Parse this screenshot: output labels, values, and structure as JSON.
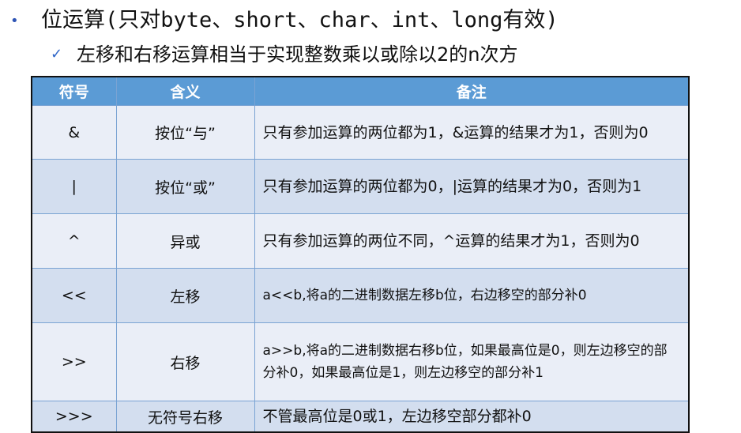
{
  "title": {
    "bullet": "•",
    "text": "位运算(只对byte、short、char、int、long有效)"
  },
  "subtitle": {
    "check": "✓",
    "text": "左移和右移运算相当于实现整数乘以或除以2的n次方"
  },
  "table": {
    "headers": [
      "符号",
      "含义",
      "备注"
    ],
    "rows": [
      {
        "symbol": "&",
        "meaning": "按位“与”",
        "note": "只有参加运算的两位都为1，&运算的结果才为1，否则为0"
      },
      {
        "symbol": "|",
        "meaning": "按位“或”",
        "note": "只有参加运算的两位都为0，|运算的结果才为0，否则为1"
      },
      {
        "symbol": "^",
        "meaning": "异或",
        "note": "只有参加运算的两位不同，^运算的结果才为1，否则为0"
      },
      {
        "symbol": "<<",
        "meaning": "左移",
        "note": "a<<b,将a的二进制数据左移b位，右边移空的部分补0"
      },
      {
        "symbol": ">>",
        "meaning": "右移",
        "note": "a>>b,将a的二进制数据右移b位，如果最高位是0，则左边移空的部分补0，如果最高位是1，则左边移空的部分补1"
      },
      {
        "symbol": ">>>",
        "meaning": "无符号右移",
        "note": "不管最高位是0或1，左边移空部分都补0"
      }
    ]
  },
  "colors": {
    "header_bg": "#5b9bd5",
    "row_light": "#eaeef7",
    "row_dark": "#d3deef",
    "bullet": "#2f55b5"
  }
}
